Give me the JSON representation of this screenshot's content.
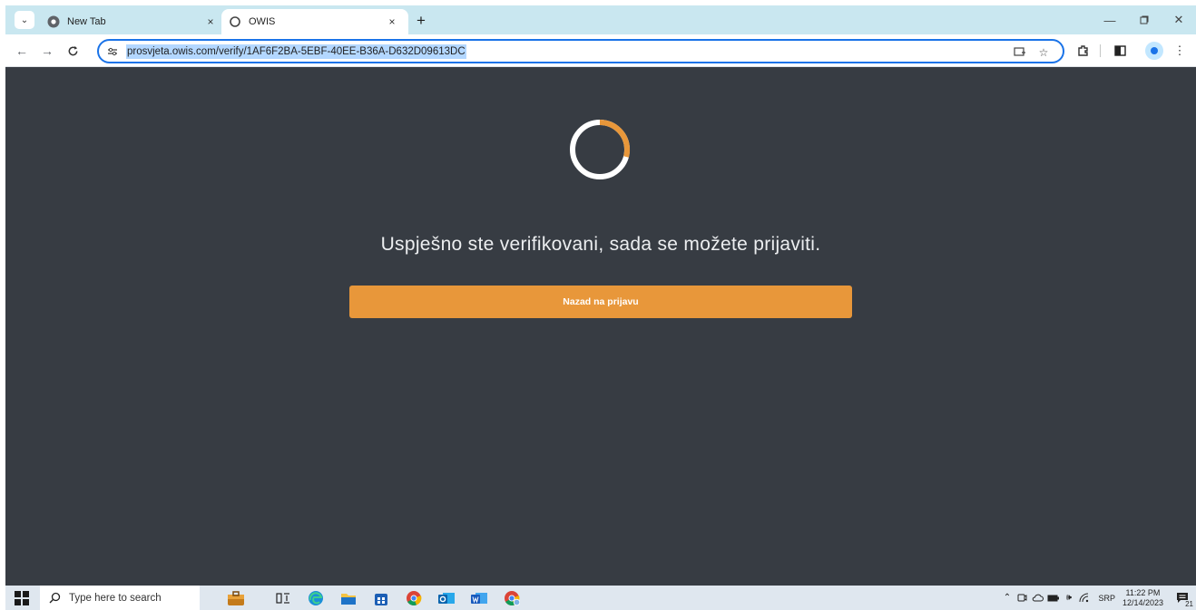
{
  "browser": {
    "tabs": [
      {
        "title": "New Tab",
        "icon": "chrome-icon",
        "active": false
      },
      {
        "title": "OWIS",
        "icon": "owis-ring-icon",
        "active": true
      }
    ],
    "tab_close_glyph": "×",
    "new_tab_glyph": "+",
    "address_bar": {
      "url": "prosvjeta.owis.com/verify/1AF6F2BA-5EBF-40EE-B36A-D632D09613DC"
    },
    "window_controls": [
      "minimize",
      "restore",
      "close"
    ]
  },
  "page": {
    "background_color": "#373c43",
    "spinner": {
      "ring_color": "#ffffff",
      "arc_color": "#e8973a"
    },
    "message": "Uspješno ste verifikovani, sada se možete prijaviti.",
    "back_button_label": "Nazad na prijavu",
    "accent_color": "#e8973a"
  },
  "taskbar": {
    "search_placeholder": "Type here to search",
    "pinned_apps": [
      "briefcase-icon",
      "task-view-icon",
      "edge-icon",
      "file-explorer-icon",
      "store-icon",
      "chrome-icon",
      "outlook-icon",
      "word-icon",
      "chrome-profile-icon"
    ],
    "tray": {
      "language": "SRP",
      "time": "11:22 PM",
      "date": "12/14/2023",
      "notification_count": "21"
    }
  }
}
